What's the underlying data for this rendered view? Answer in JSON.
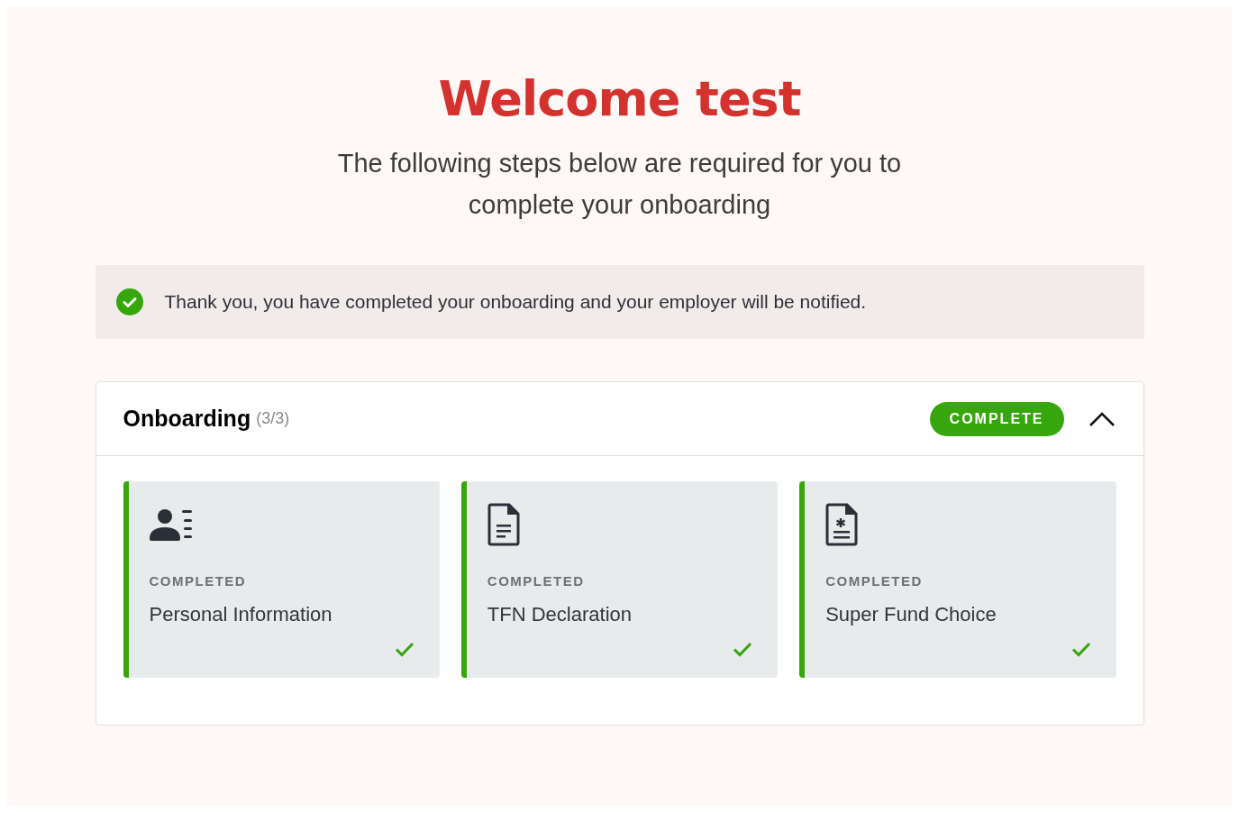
{
  "title": "Welcome test",
  "subtitle": "The following steps below are required for you to complete your onboarding",
  "banner": {
    "kind": "success",
    "text": "Thank you, you have completed your onboarding and your employer will be notified."
  },
  "section": {
    "title": "Onboarding",
    "count": "(3/3)",
    "status": "COMPLETE",
    "expanded": true,
    "steps": [
      {
        "kind": "person",
        "status": "COMPLETED",
        "name": "Personal Information",
        "completed": true
      },
      {
        "kind": "document",
        "status": "COMPLETED",
        "name": "TFN Declaration",
        "completed": true
      },
      {
        "kind": "form",
        "status": "COMPLETED",
        "name": "Super Fund Choice",
        "completed": true
      }
    ]
  }
}
